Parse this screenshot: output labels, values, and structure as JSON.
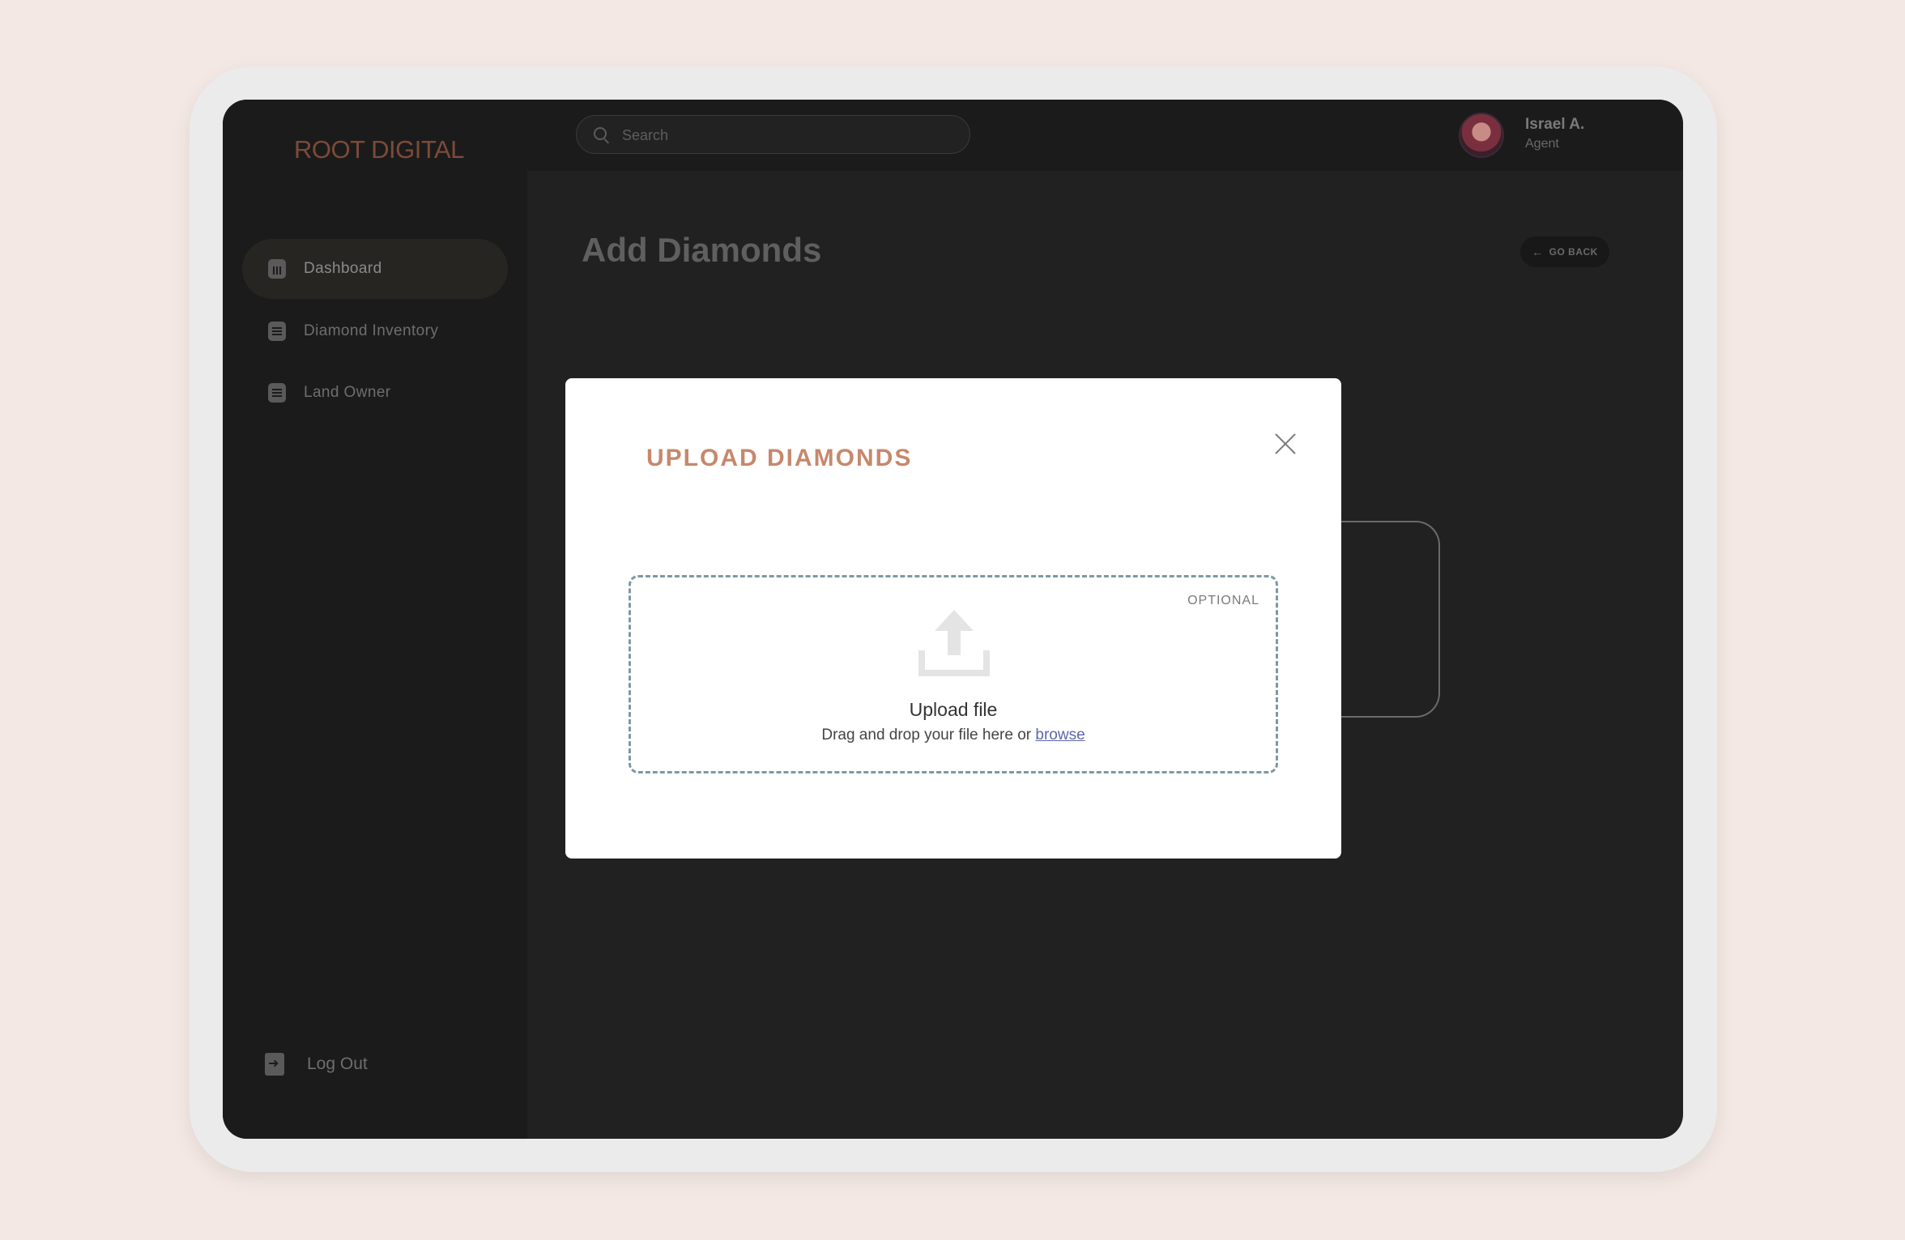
{
  "sidebar": {
    "brand": "ROOT DIGITAL",
    "items": [
      {
        "label": "Dashboard",
        "icon": "chart-icon",
        "active": true
      },
      {
        "label": "Diamond Inventory",
        "icon": "document-icon",
        "active": false
      },
      {
        "label": "Land Owner",
        "icon": "document-icon",
        "active": false
      }
    ],
    "logout_label": "Log Out"
  },
  "header": {
    "search_placeholder": "Search",
    "user_name": "Israel A.",
    "user_role": "Agent"
  },
  "main": {
    "title": "Add Diamonds",
    "go_back_label": "GO BACK"
  },
  "modal": {
    "title": "UPLOAD DIAMONDS",
    "optional_label": "OPTIONAL",
    "upload_label": "Upload file",
    "hint_text": "Drag and drop your file here or",
    "browse_label": "browse"
  },
  "colors": {
    "page_background": "#f3e8e3",
    "brand": "#7d4a39",
    "modal_title": "#c6886d",
    "dropzone_border": "#7e98a3",
    "link": "#5d66a8"
  }
}
